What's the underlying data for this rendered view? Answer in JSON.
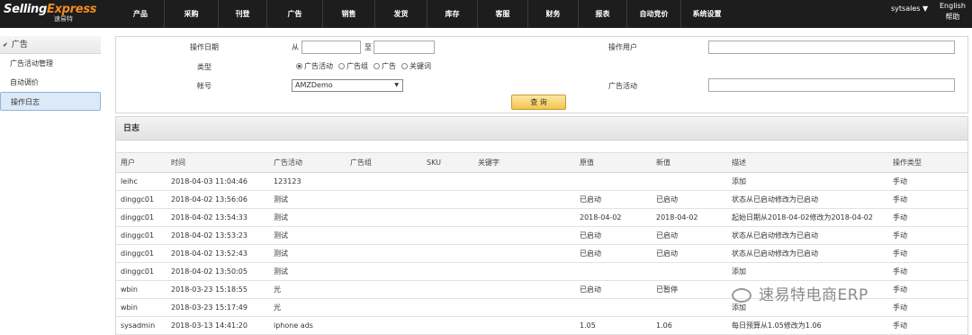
{
  "brand": {
    "name_part1": "Selling",
    "name_part2": "Express",
    "sub": "速易特"
  },
  "nav": {
    "items": [
      "产品",
      "采购",
      "刊登",
      "广告",
      "销售",
      "发货",
      "库存",
      "客服",
      "财务",
      "报表",
      "自动竞价",
      "系统设置"
    ],
    "user": "sytsales ▼",
    "lang": "English",
    "help": "帮助"
  },
  "sidebar": {
    "section": "广告",
    "items": [
      "广告活动管理",
      "自动调价",
      "操作日志"
    ]
  },
  "filters": {
    "op_date_label": "操作日期",
    "from_label": "从",
    "to_label": "至",
    "op_user_label": "操作用户",
    "type_label": "类型",
    "types": [
      "广告活动",
      "广告组",
      "广告",
      "关键词"
    ],
    "account_label": "帐号",
    "account_value": "AMZDemo",
    "campaign_label": "广告活动",
    "query_button": "查 询"
  },
  "log": {
    "title": "日志",
    "columns": [
      "用户",
      "时间",
      "广告活动",
      "广告组",
      "SKU",
      "关键字",
      "原值",
      "新值",
      "描述",
      "操作类型"
    ],
    "rows": [
      [
        "leihc",
        "2018-04-03 11:04:46",
        "123123",
        "",
        "",
        "",
        "",
        "",
        "添加",
        "手动"
      ],
      [
        "dinggc01",
        "2018-04-02 13:56:06",
        "测试",
        "",
        "",
        "",
        "已启动",
        "已启动",
        "状态从已启动修改为已启动",
        "手动"
      ],
      [
        "dinggc01",
        "2018-04-02 13:54:33",
        "测试",
        "",
        "",
        "",
        "2018-04-02",
        "2018-04-02",
        "起始日期从2018-04-02修改为2018-04-02",
        "手动"
      ],
      [
        "dinggc01",
        "2018-04-02 13:53:23",
        "测试",
        "",
        "",
        "",
        "已启动",
        "已启动",
        "状态从已启动修改为已启动",
        "手动"
      ],
      [
        "dinggc01",
        "2018-04-02 13:52:43",
        "测试",
        "",
        "",
        "",
        "已启动",
        "已启动",
        "状态从已启动修改为已启动",
        "手动"
      ],
      [
        "dinggc01",
        "2018-04-02 13:50:05",
        "测试",
        "",
        "",
        "",
        "",
        "",
        "添加",
        "手动"
      ],
      [
        "wbin",
        "2018-03-23 15:18:55",
        "光",
        "",
        "",
        "",
        "已启动",
        "已暂停",
        "",
        "手动"
      ],
      [
        "wbin",
        "2018-03-23 15:17:49",
        "光",
        "",
        "",
        "",
        "",
        "",
        "添加",
        "手动"
      ],
      [
        "sysadmin",
        "2018-03-13 14:41:20",
        "iphone ads",
        "",
        "",
        "",
        "1.05",
        "1.06",
        "每日预算从1.05修改为1.06",
        "手动"
      ]
    ]
  },
  "watermark": "速易特电商ERP"
}
